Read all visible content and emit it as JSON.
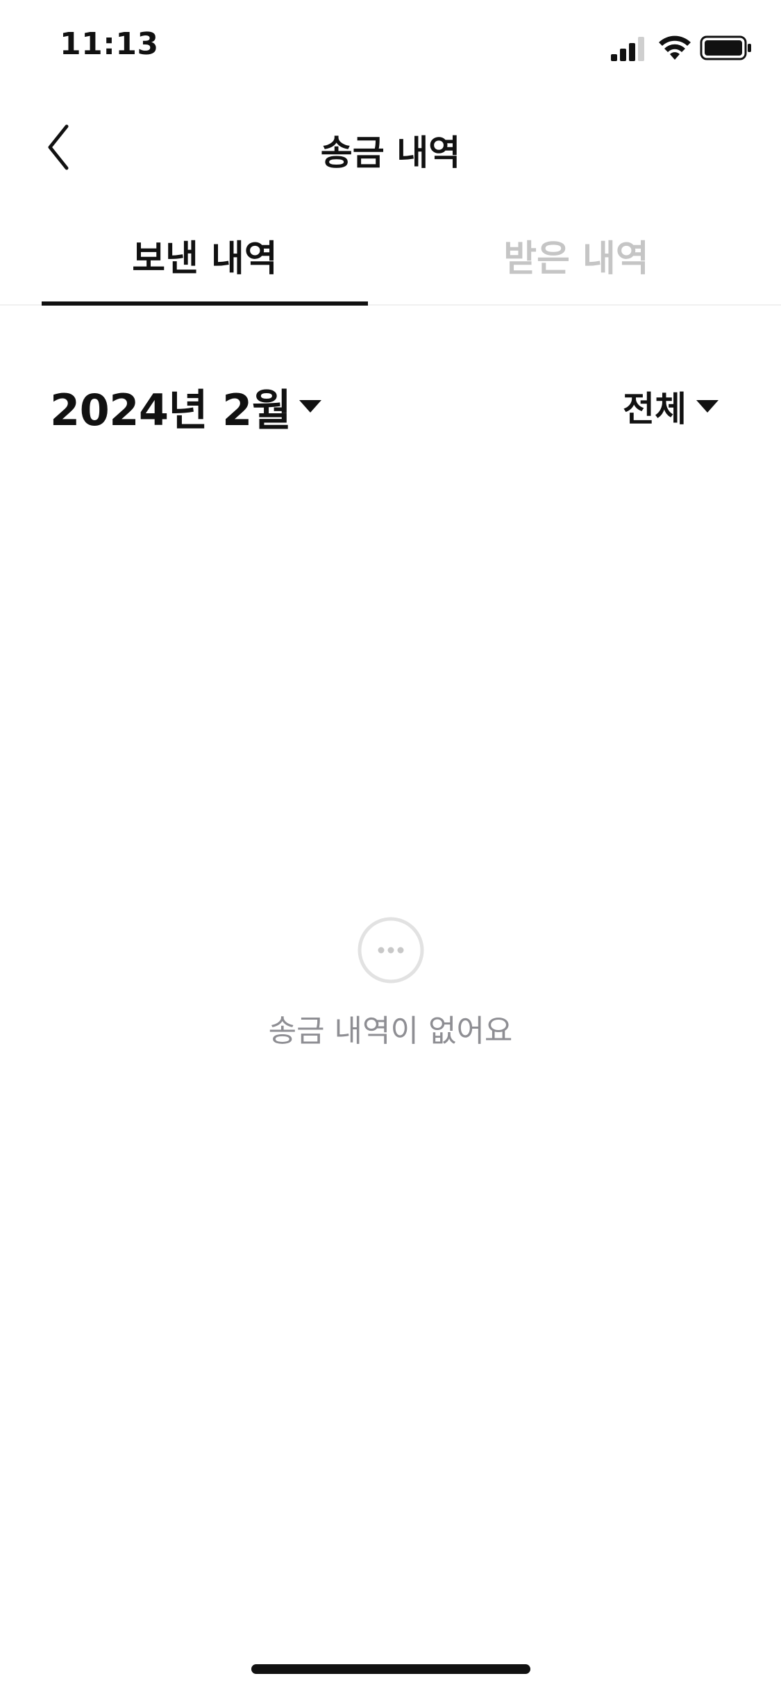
{
  "status_bar": {
    "time": "11:13",
    "icons": [
      "signal-icon",
      "wifi-icon",
      "battery-icon"
    ]
  },
  "nav": {
    "back_icon": "chevron-left-icon",
    "title": "송금 내역"
  },
  "tabs": [
    {
      "label": "보낸 내역",
      "active": true
    },
    {
      "label": "받은 내역",
      "active": false
    }
  ],
  "filters": {
    "month": "2024년 2월",
    "type": "전체",
    "caret_icon": "caret-down-icon"
  },
  "empty_state": {
    "icon": "more-horizontal-circle-icon",
    "message": "송금 내역이 없어요"
  },
  "colors": {
    "text_primary": "#111111",
    "text_inactive": "#c5c5c5",
    "text_muted": "#8e8e93",
    "divider": "#f1f1f1",
    "background": "#ffffff"
  }
}
